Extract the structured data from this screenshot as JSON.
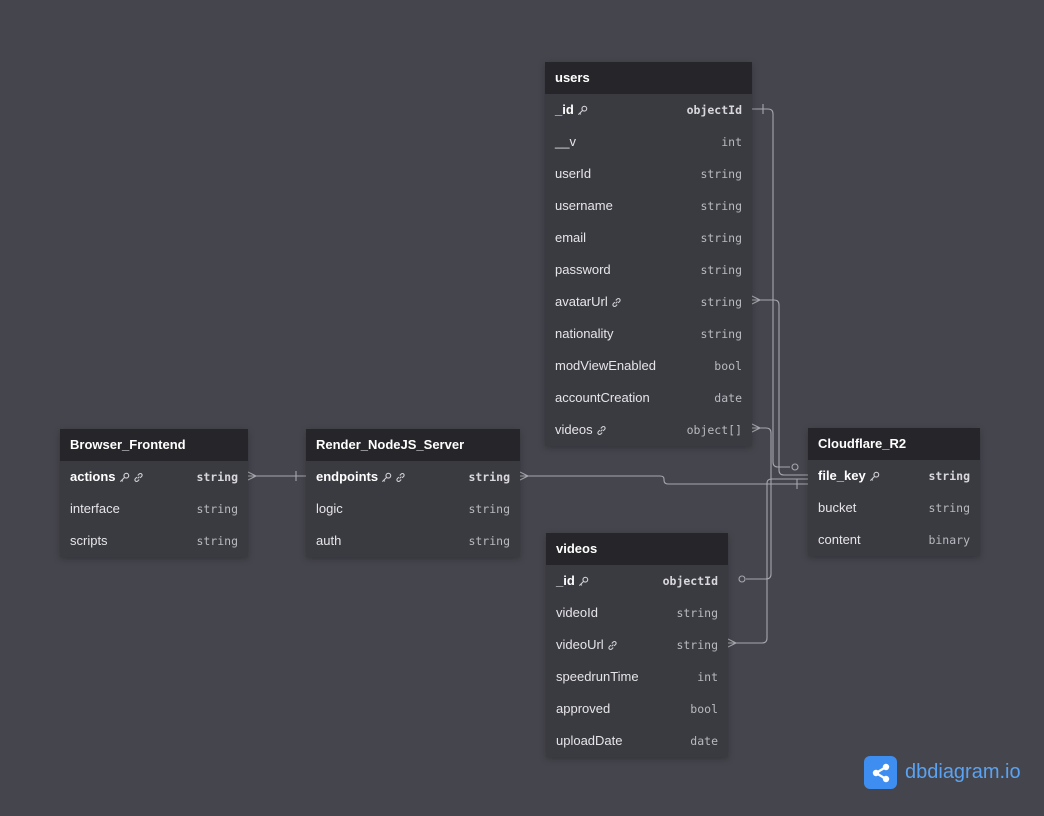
{
  "diagram": {
    "tables": [
      {
        "id": "users",
        "name": "users",
        "fields": [
          {
            "name": "_id",
            "type": "objectId",
            "pk": true,
            "icons": [
              "key-icon"
            ]
          },
          {
            "name": "__v",
            "type": "int",
            "icons": []
          },
          {
            "name": "userId",
            "type": "string",
            "icons": []
          },
          {
            "name": "username",
            "type": "string",
            "icons": []
          },
          {
            "name": "email",
            "type": "string",
            "icons": []
          },
          {
            "name": "password",
            "type": "string",
            "icons": []
          },
          {
            "name": "avatarUrl",
            "type": "string",
            "icons": [
              "link-icon"
            ]
          },
          {
            "name": "nationality",
            "type": "string",
            "icons": []
          },
          {
            "name": "modViewEnabled",
            "type": "bool",
            "icons": []
          },
          {
            "name": "accountCreation",
            "type": "date",
            "icons": []
          },
          {
            "name": "videos",
            "type": "object[]",
            "icons": [
              "link-icon"
            ]
          }
        ]
      },
      {
        "id": "browser-frontend",
        "name": "Browser_Frontend",
        "fields": [
          {
            "name": "actions",
            "type": "string",
            "pk": true,
            "icons": [
              "key-icon",
              "link-icon"
            ]
          },
          {
            "name": "interface",
            "type": "string",
            "icons": []
          },
          {
            "name": "scripts",
            "type": "string",
            "icons": []
          }
        ]
      },
      {
        "id": "render-nodejs-server",
        "name": "Render_NodeJS_Server",
        "fields": [
          {
            "name": "endpoints",
            "type": "string",
            "pk": true,
            "icons": [
              "key-icon",
              "link-icon"
            ]
          },
          {
            "name": "logic",
            "type": "string",
            "icons": []
          },
          {
            "name": "auth",
            "type": "string",
            "icons": []
          }
        ]
      },
      {
        "id": "cloudflare-r2",
        "name": "Cloudflare_R2",
        "fields": [
          {
            "name": "file_key",
            "type": "string",
            "pk": true,
            "icons": [
              "key-icon"
            ]
          },
          {
            "name": "bucket",
            "type": "string",
            "icons": []
          },
          {
            "name": "content",
            "type": "binary",
            "icons": []
          }
        ]
      },
      {
        "id": "videos",
        "name": "videos",
        "fields": [
          {
            "name": "_id",
            "type": "objectId",
            "pk": true,
            "icons": [
              "key-icon"
            ]
          },
          {
            "name": "videoId",
            "type": "string",
            "icons": []
          },
          {
            "name": "videoUrl",
            "type": "string",
            "icons": [
              "link-icon"
            ]
          },
          {
            "name": "speedrunTime",
            "type": "int",
            "icons": []
          },
          {
            "name": "approved",
            "type": "bool",
            "icons": []
          },
          {
            "name": "uploadDate",
            "type": "date",
            "icons": []
          }
        ]
      }
    ],
    "relationships": [
      {
        "from": "Browser_Frontend.actions",
        "to": "Render_NodeJS_Server.endpoints",
        "cardinality": "many-to-one"
      },
      {
        "from": "Render_NodeJS_Server.endpoints",
        "to": "Cloudflare_R2.file_key",
        "cardinality": "many-to-one"
      },
      {
        "from": "users.avatarUrl",
        "to": "Cloudflare_R2.file_key",
        "cardinality": "many-to-one"
      },
      {
        "from": "videos.videoUrl",
        "to": "Cloudflare_R2.file_key",
        "cardinality": "many-to-one"
      },
      {
        "from": "users.videos",
        "to": "videos._id",
        "cardinality": "many-to-zero-or-one"
      }
    ],
    "colors": {
      "background": "#45454d",
      "header": "#26262a",
      "body": "#3a3a41",
      "connector": "#a7a7ae",
      "logo_accent": "#3d8ef0"
    }
  },
  "branding": {
    "logo_text": "dbdiagram.io",
    "logo_icon": "share-icon"
  }
}
